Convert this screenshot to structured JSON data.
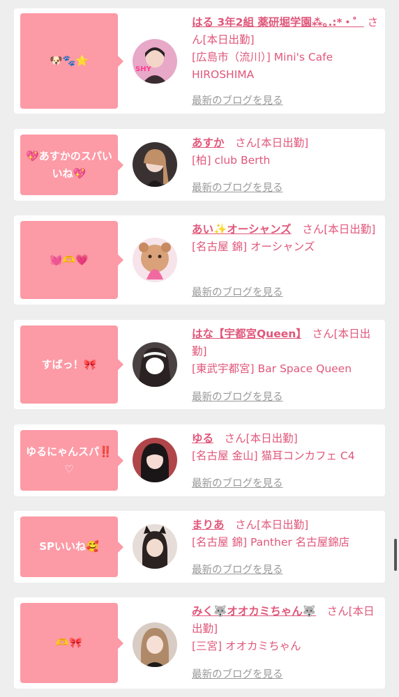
{
  "entries": [
    {
      "bubble": "🐶🐾⭐",
      "name": "はる 3年2組 薬研堀学園⁂｡.:*・゜",
      "suffix": " さん[本日出勤]",
      "shop": "[広島市（流川）] Mini's Cafe HIROSHIMA",
      "blog": "最新のブログを見る",
      "avatar_color": "#c87aa0"
    },
    {
      "bubble": "💖あすかのスパいいね💖",
      "name": "あすか",
      "suffix": "　さん[本日出勤]",
      "shop": "[柏] club Berth",
      "blog": "最新のブログを見る",
      "avatar_color": "#4a4040"
    },
    {
      "bubble": "💓🫶💗",
      "name": "あい✨オーシャンズ",
      "suffix": "　さん[本日出勤]",
      "shop": "[名古屋 錦] オーシャンズ",
      "blog": "最新のブログを見る",
      "avatar_color": "#d9a27a"
    },
    {
      "bubble": "すばっ！🎀",
      "name": "はな【宇都宮Queen】",
      "suffix": "　さん[本日出勤]",
      "shop": "[東武宇都宮] Bar Space Queen",
      "blog": "最新のブログを見る",
      "avatar_color": "#4b4444"
    },
    {
      "bubble": "ゆるにゃんスパ‼️♡",
      "name": "ゆる",
      "suffix": "　さん[本日出勤]",
      "shop": "[名古屋 金山] 猫耳コンカフェ C4",
      "blog": "最新のブログを見る",
      "avatar_color": "#b0454a"
    },
    {
      "bubble": "SPいいね🥰",
      "name": "まりあ",
      "suffix": "　さん[本日出勤]",
      "shop": "[名古屋 錦] Panther 名古屋錦店",
      "blog": "最新のブログを見る",
      "avatar_color": "#d8c8c0"
    },
    {
      "bubble": "🫶🎀",
      "name": "みく🐺オオカミちゃん🐺",
      "suffix": "　さん[本日出勤]",
      "shop": "[三宮] オオカミちゃん",
      "blog": "最新のブログを見る",
      "avatar_color": "#a08878"
    }
  ]
}
